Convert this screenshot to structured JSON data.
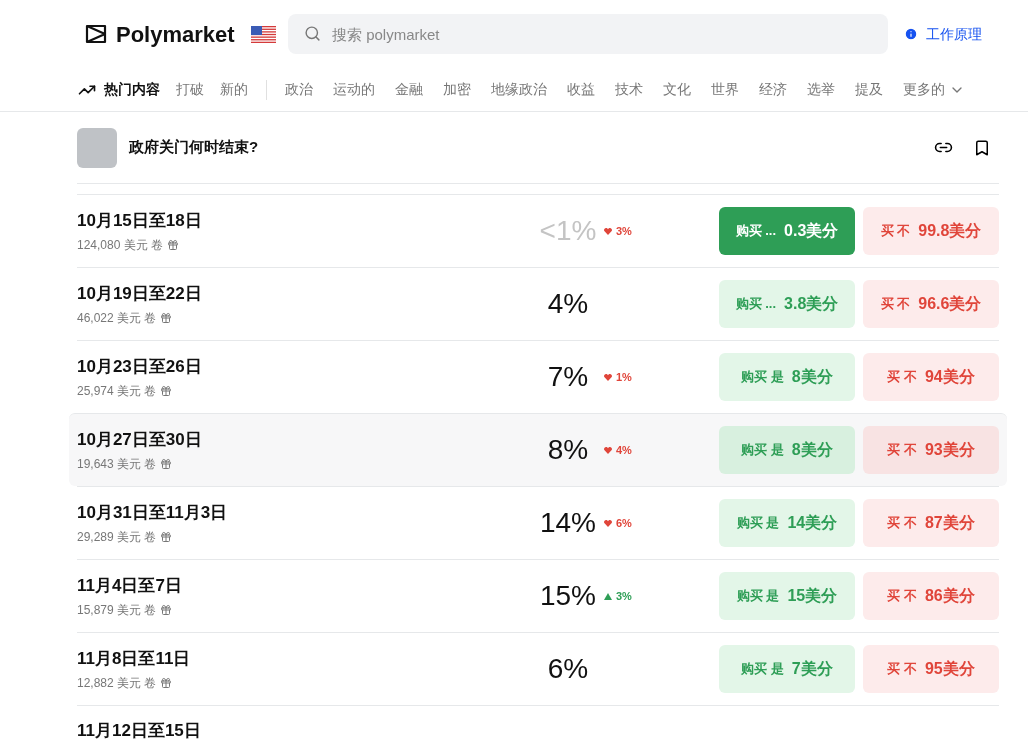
{
  "brand": {
    "name": "Polymarket"
  },
  "search": {
    "placeholder": "搜索 polymarket"
  },
  "how_it_works": "工作原理",
  "nav_main": [
    {
      "label": "热门内容",
      "selected": true
    },
    {
      "label": "打破",
      "selected": false
    },
    {
      "label": "新的",
      "selected": false
    }
  ],
  "nav_topics": [
    {
      "label": "政治",
      "selected": false
    },
    {
      "label": "运动的",
      "selected": false
    },
    {
      "label": "金融",
      "selected": false
    },
    {
      "label": "加密",
      "selected": false
    },
    {
      "label": "地缘政治",
      "selected": false
    },
    {
      "label": "收益",
      "selected": false
    },
    {
      "label": "技术",
      "selected": false
    },
    {
      "label": "文化",
      "selected": false
    },
    {
      "label": "世界",
      "selected": false
    },
    {
      "label": "经济",
      "selected": false
    },
    {
      "label": "选举",
      "selected": false
    },
    {
      "label": "提及",
      "selected": false
    }
  ],
  "nav_more": "更多的",
  "event": {
    "title": "政府关门何时结束?"
  },
  "rows": [
    {
      "kind": "full",
      "title": "10月15日至18日",
      "volume": "124,080 美元 卷",
      "percent": "<1%",
      "faint": true,
      "change": "3%",
      "rising": false,
      "buy_label": "购买 ...",
      "buy_price": "0.3美分",
      "buy_active": true,
      "no_label": "买 不",
      "no_price": "99.8美分",
      "highlighted": false
    },
    {
      "kind": "full",
      "title": "10月19日至22日",
      "volume": "46,022 美元 卷",
      "percent": "4%",
      "faint": false,
      "buy_label": "购买 ...",
      "buy_price": "3.8美分",
      "buy_active": false,
      "no_label": "买 不",
      "no_price": "96.6美分",
      "highlighted": false
    },
    {
      "kind": "full",
      "title": "10月23日至26日",
      "volume": "25,974 美元 卷",
      "percent": "7%",
      "faint": false,
      "change": "1%",
      "rising": false,
      "buy_label": "购买 是",
      "buy_price": "8美分",
      "buy_active": false,
      "no_label": "买 不",
      "no_price": "94美分",
      "highlighted": false
    },
    {
      "kind": "full",
      "title": "10月27日至30日",
      "volume": "19,643 美元 卷",
      "percent": "8%",
      "faint": false,
      "change": "4%",
      "rising": false,
      "buy_label": "购买 是",
      "buy_price": "8美分",
      "buy_active": false,
      "no_label": "买 不",
      "no_price": "93美分",
      "highlighted": true
    },
    {
      "kind": "full",
      "title": "10月31日至11月3日",
      "volume": "29,289 美元 卷",
      "percent": "14%",
      "faint": false,
      "change": "6%",
      "rising": false,
      "buy_label": "购买 是",
      "buy_price": "14美分",
      "buy_active": false,
      "no_label": "买 不",
      "no_price": "87美分",
      "highlighted": false
    },
    {
      "kind": "full",
      "title": "11月4日至7日",
      "volume": "15,879 美元 卷",
      "percent": "15%",
      "faint": false,
      "change": "3%",
      "rising": true,
      "buy_label": "购买 是",
      "buy_price": "15美分",
      "buy_active": false,
      "no_label": "买 不",
      "no_price": "86美分",
      "highlighted": false
    },
    {
      "kind": "full",
      "title": "11月8日至11日",
      "volume": "12,882 美元 卷",
      "percent": "6%",
      "faint": false,
      "buy_label": "购买 是",
      "buy_price": "7美分",
      "buy_active": false,
      "no_label": "买 不",
      "no_price": "95美分",
      "highlighted": false
    },
    {
      "kind": "partial",
      "title": "11月12日至15日",
      "highlighted": false
    }
  ]
}
